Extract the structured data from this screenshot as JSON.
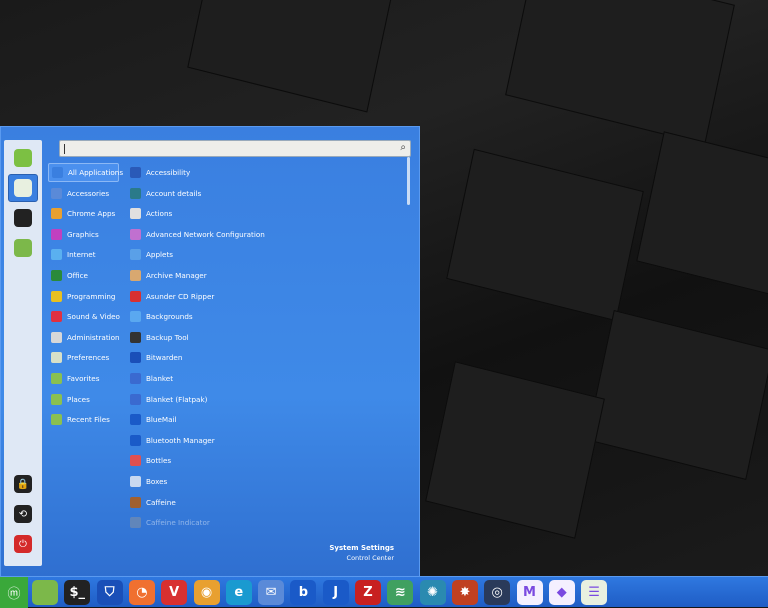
{
  "search": {
    "value": "",
    "icon": "search-icon"
  },
  "sidebar": {
    "favorites": [
      {
        "name": "web-browser",
        "color": "#7cc043",
        "active": false
      },
      {
        "name": "system-settings",
        "color": "#e8f0e0",
        "active": true
      },
      {
        "name": "terminal",
        "color": "#222222",
        "active": false
      },
      {
        "name": "files",
        "color": "#7cb84a",
        "active": false
      }
    ],
    "session": [
      {
        "name": "lock-screen",
        "color": "#222222",
        "glyph": "🔒"
      },
      {
        "name": "logout",
        "color": "#222222",
        "glyph": "⟲"
      },
      {
        "name": "shutdown",
        "color": "#d42a2a",
        "glyph": "⏻"
      }
    ]
  },
  "categories": [
    {
      "label": "All Applications",
      "color": "#3a7fe0",
      "selected": true
    },
    {
      "label": "Accessories",
      "color": "#5a8ad8"
    },
    {
      "label": "Chrome Apps",
      "color": "#e8a030"
    },
    {
      "label": "Graphics",
      "color": "#c040c0"
    },
    {
      "label": "Internet",
      "color": "#5ab0f0"
    },
    {
      "label": "Office",
      "color": "#2a8a3a"
    },
    {
      "label": "Programming",
      "color": "#e8c020"
    },
    {
      "label": "Sound & Video",
      "color": "#e03040"
    },
    {
      "label": "Administration",
      "color": "#d8d8d8"
    },
    {
      "label": "Preferences",
      "color": "#d8e0c8"
    },
    {
      "label": "Favorites",
      "color": "#8ac050"
    },
    {
      "label": "Places",
      "color": "#8ac050"
    },
    {
      "label": "Recent Files",
      "color": "#8ac050"
    }
  ],
  "apps": [
    {
      "label": "Accessibility",
      "color": "#2a5ab8"
    },
    {
      "label": "Account details",
      "color": "#2a7a8a"
    },
    {
      "label": "Actions",
      "color": "#e0e0e0"
    },
    {
      "label": "Advanced Network Configuration",
      "color": "#c070d0"
    },
    {
      "label": "Applets",
      "color": "#5aa0e8"
    },
    {
      "label": "Archive Manager",
      "color": "#d8a870"
    },
    {
      "label": "Asunder CD Ripper",
      "color": "#d83030"
    },
    {
      "label": "Backgrounds",
      "color": "#5aa8f0"
    },
    {
      "label": "Backup Tool",
      "color": "#333333"
    },
    {
      "label": "Bitwarden",
      "color": "#1a4fb8"
    },
    {
      "label": "Blanket",
      "color": "#3a6ad0"
    },
    {
      "label": "Blanket (Flatpak)",
      "color": "#3a6ad0"
    },
    {
      "label": "BlueMail",
      "color": "#1a5ac8"
    },
    {
      "label": "Bluetooth Manager",
      "color": "#1a5ac8"
    },
    {
      "label": "Bottles",
      "color": "#e05050"
    },
    {
      "label": "Boxes",
      "color": "#c8d8f0"
    },
    {
      "label": "Caffeine",
      "color": "#a06030"
    },
    {
      "label": "Caffeine Indicator",
      "color": "#999999",
      "dim": true
    }
  ],
  "selected_app": {
    "name": "System Settings",
    "description": "Control Center"
  },
  "taskbar": {
    "menu_icon": "linux-mint-logo-icon",
    "items": [
      {
        "name": "files",
        "color": "#7cb84a",
        "glyph": ""
      },
      {
        "name": "terminal",
        "color": "#222222",
        "glyph": "$_"
      },
      {
        "name": "bitwarden",
        "color": "#1a4fb8",
        "glyph": "⛉"
      },
      {
        "name": "firefox",
        "color": "#f07030",
        "glyph": "◔"
      },
      {
        "name": "vivaldi",
        "color": "#d83030",
        "glyph": "V"
      },
      {
        "name": "chrome",
        "color": "#e8a030",
        "glyph": "◉"
      },
      {
        "name": "edge",
        "color": "#1a9ad0",
        "glyph": "e"
      },
      {
        "name": "mail",
        "color": "#5a8ad8",
        "glyph": "✉"
      },
      {
        "name": "bluemail",
        "color": "#1a5ac8",
        "glyph": "b"
      },
      {
        "name": "joplin",
        "color": "#1a5ac8",
        "glyph": "J"
      },
      {
        "name": "zotero",
        "color": "#c82020",
        "glyph": "Z"
      },
      {
        "name": "layers",
        "color": "#40a060",
        "glyph": "≋"
      },
      {
        "name": "shutter",
        "color": "#2a8ab0",
        "glyph": "✺"
      },
      {
        "name": "darktable",
        "color": "#c04020",
        "glyph": "✸"
      },
      {
        "name": "camera",
        "color": "#2a3a5a",
        "glyph": "◎"
      },
      {
        "name": "proton-mail",
        "color": "#f4f0ff",
        "glyph": "M"
      },
      {
        "name": "proton-pass",
        "color": "#f4f0ff",
        "glyph": "◆"
      },
      {
        "name": "system-settings",
        "color": "#e8f0e0",
        "glyph": "☰"
      }
    ]
  }
}
